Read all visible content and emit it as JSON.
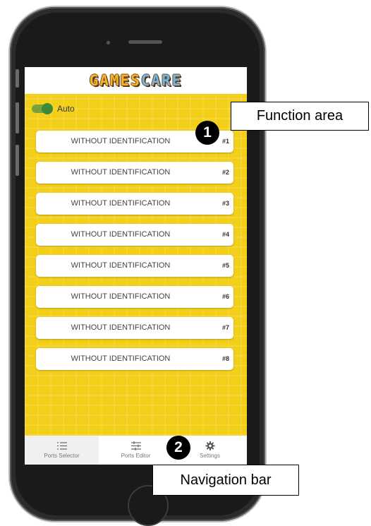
{
  "app": {
    "logo_part1": "GAMES",
    "logo_part2": "CARE"
  },
  "auto": {
    "label": "Auto",
    "enabled": true
  },
  "ports": [
    {
      "label": "WITHOUT IDENTIFICATION",
      "num": "#1"
    },
    {
      "label": "WITHOUT IDENTIFICATION",
      "num": "#2"
    },
    {
      "label": "WITHOUT IDENTIFICATION",
      "num": "#3"
    },
    {
      "label": "WITHOUT IDENTIFICATION",
      "num": "#4"
    },
    {
      "label": "WITHOUT IDENTIFICATION",
      "num": "#5"
    },
    {
      "label": "WITHOUT IDENTIFICATION",
      "num": "#6"
    },
    {
      "label": "WITHOUT IDENTIFICATION",
      "num": "#7"
    },
    {
      "label": "WITHOUT IDENTIFICATION",
      "num": "#8"
    }
  ],
  "nav": [
    {
      "label": "Ports Selector",
      "icon": "list-icon",
      "active": true
    },
    {
      "label": "Ports Editor",
      "icon": "sliders-icon",
      "active": false
    },
    {
      "label": "Settings",
      "icon": "gear-icon",
      "active": false
    }
  ],
  "annotations": {
    "function_area": {
      "number": "1",
      "label": "Function area"
    },
    "navigation_bar": {
      "number": "2",
      "label": "Navigation bar"
    }
  },
  "colors": {
    "background_yellow": "#f3cf1a",
    "toggle_green": "#3b8a3b"
  }
}
